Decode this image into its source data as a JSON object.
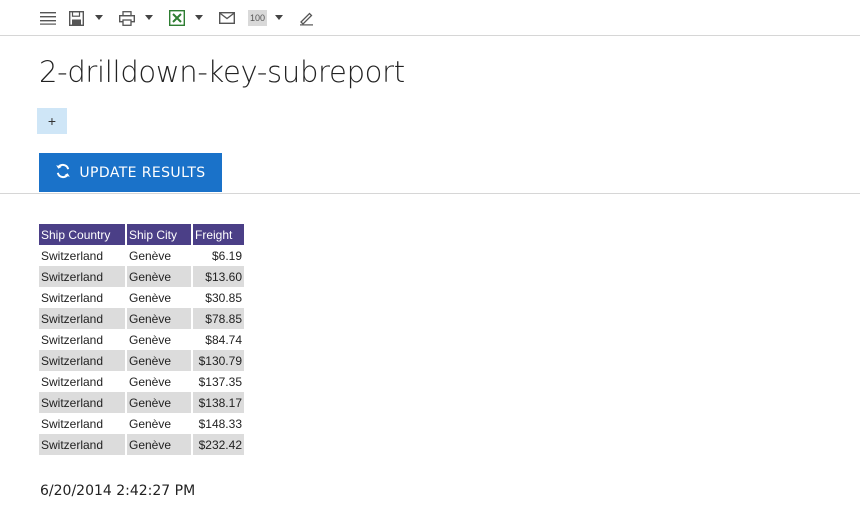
{
  "toolbar": {
    "icons": [
      "menu-icon",
      "save-icon",
      "print-icon",
      "excel-icon",
      "mail-icon",
      "zoom-icon",
      "edit-icon"
    ],
    "zoom_label": "100"
  },
  "page": {
    "title": "2-drilldown-key-subreport",
    "add_label": "+",
    "update_label": "UPDATE RESULTS"
  },
  "report": {
    "header_color": "#4b3f87",
    "columns": [
      "Ship Country",
      "Ship City",
      "Freight"
    ],
    "rows": [
      [
        "Switzerland",
        "Genève",
        "$6.19"
      ],
      [
        "Switzerland",
        "Genève",
        "$13.60"
      ],
      [
        "Switzerland",
        "Genève",
        "$30.85"
      ],
      [
        "Switzerland",
        "Genève",
        "$78.85"
      ],
      [
        "Switzerland",
        "Genève",
        "$84.74"
      ],
      [
        "Switzerland",
        "Genève",
        "$130.79"
      ],
      [
        "Switzerland",
        "Genève",
        "$137.35"
      ],
      [
        "Switzerland",
        "Genève",
        "$138.17"
      ],
      [
        "Switzerland",
        "Genève",
        "$148.33"
      ],
      [
        "Switzerland",
        "Genève",
        "$232.42"
      ]
    ]
  },
  "footer": {
    "timestamp": "6/20/2014 2:42:27 PM"
  }
}
